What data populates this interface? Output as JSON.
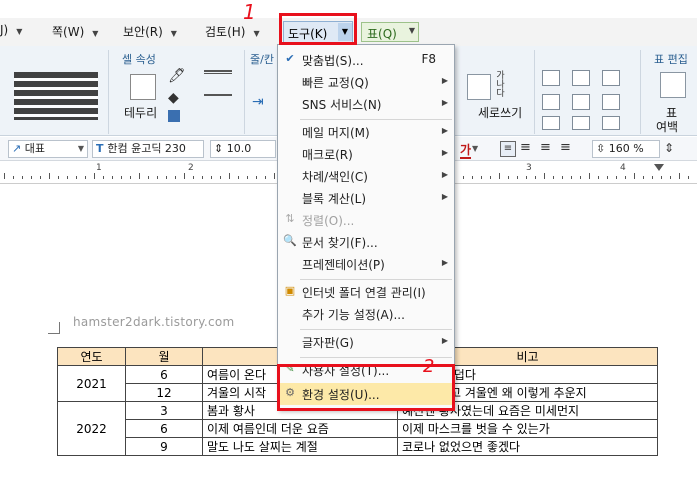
{
  "menubar": {
    "tabs": [
      {
        "label": "J)"
      },
      {
        "label": "쪽(W)"
      },
      {
        "label": "보안(R)"
      },
      {
        "label": "검토(H)"
      },
      {
        "label": "도구(K)"
      },
      {
        "label": "표(Q)"
      }
    ],
    "active_tab": "도구(K)"
  },
  "ribbon": {
    "groups": {
      "cell_props": "셀 속성",
      "line": "줄/칸",
      "table_edit": "표 편집"
    },
    "buttons": {
      "border": "테두리",
      "vertical_write": "세로쓰기",
      "table_margin_1": "표",
      "table_margin_2": "여백"
    },
    "vertical_glyph": "가나다"
  },
  "format_bar": {
    "style": "대표",
    "font": "한컴 윤고딕 230",
    "size": "10.0",
    "zoom": "160",
    "zoom_unit": "%",
    "font_color_label": "가"
  },
  "ruler": {
    "numbers": [
      "1",
      "2",
      "3",
      "4"
    ]
  },
  "document": {
    "watermark": "hamster2dark.tistory.com",
    "table": {
      "headers": [
        "연도",
        "월",
        "",
        "비고"
      ],
      "rows": [
        {
          "year": "2021",
          "month": "6",
          "content": "여름이 온다",
          "note": "너무 너무 덥다"
        },
        {
          "year": "",
          "month": "12",
          "content": "겨울의 시작",
          "note": "여름엔 덥고 겨울엔 왜 이렇게 추운지"
        },
        {
          "year": "2022",
          "month": "3",
          "content": "봄과 황사",
          "note": "예전엔 황사였는데 요즘은 미세먼지"
        },
        {
          "year": "",
          "month": "6",
          "content": "이제 여름인데 더운 요즘",
          "note": "이제 마스크를 벗을 수 있는가"
        },
        {
          "year": "",
          "month": "9",
          "content": "말도 나도 살찌는 계절",
          "note": "코로나 없었으면 좋겠다"
        }
      ]
    }
  },
  "tools_menu": {
    "items": [
      {
        "label": "맞춤법(S)...",
        "shortcut": "F8",
        "icon": "spellcheck-icon",
        "sub": false
      },
      {
        "label": "빠른 교정(Q)",
        "sub": true
      },
      {
        "label": "SNS 서비스(N)",
        "sub": true
      },
      {
        "label": "메일 머지(M)",
        "sub": true
      },
      {
        "label": "매크로(R)",
        "sub": true
      },
      {
        "label": "차례/색인(C)",
        "sub": true
      },
      {
        "label": "블록 계산(L)",
        "sub": true
      },
      {
        "label": "정렬(O)...",
        "disabled": true,
        "icon": "sort-icon"
      },
      {
        "label": "문서 찾기(F)...",
        "icon": "find-document-icon"
      },
      {
        "label": "프레젠테이션(P)",
        "sub": true
      },
      {
        "label": "인터넷 폴더 연결 관리(I)",
        "icon": "internet-folder-icon"
      },
      {
        "label": "추가 기능 설정(A)..."
      },
      {
        "label": "글자판(G)",
        "sub": true
      },
      {
        "label": "사용자 설정(T)...",
        "icon": "user-settings-icon"
      },
      {
        "label": "환경 설정(U)...",
        "icon": "gear-icon",
        "highlighted": true
      }
    ]
  },
  "annotations": {
    "step1": "1",
    "step2": "2"
  },
  "colors": {
    "annotation_red": "#e8101c",
    "header_fill": "#fce4bf",
    "menu_highlight": "#fde9a8",
    "ribbon_bg": "#eef3f8"
  }
}
